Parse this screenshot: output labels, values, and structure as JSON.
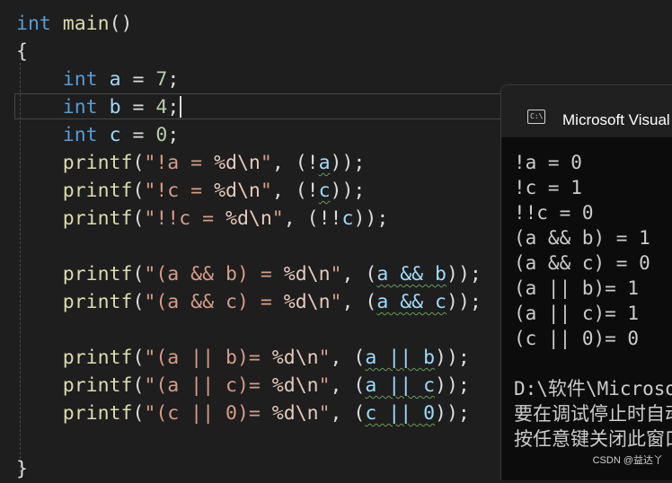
{
  "editor": {
    "lines": [
      {
        "kw": "int",
        "fn": "main",
        "rest": "()"
      },
      {
        "text": "{"
      },
      {
        "kw": "int",
        "var": "a",
        "eq": " = ",
        "num": "7",
        "end": ";"
      },
      {
        "kw": "int",
        "var": "b",
        "eq": " = ",
        "num": "4",
        "end": ";"
      },
      {
        "kw": "int",
        "var": "c",
        "eq": " = ",
        "num": "0",
        "end": ";"
      },
      {
        "fn": "printf",
        "p1": "(",
        "str": "\"!a = ",
        "fmt": "%d",
        "esc": "\\n",
        "q": "\"",
        "mid": ", (!",
        "v": "a",
        "tail": "));"
      },
      {
        "fn": "printf",
        "p1": "(",
        "str": "\"!c = ",
        "fmt": "%d",
        "esc": "\\n",
        "q": "\"",
        "mid": ", (!",
        "v": "c",
        "tail": "));"
      },
      {
        "fn": "printf",
        "p1": "(",
        "str": "\"!!c = ",
        "fmt": "%d",
        "esc": "\\n",
        "q": "\"",
        "mid": ", (!!",
        "v": "c",
        "tail": "));"
      },
      {
        "fn": "printf",
        "p1": "(",
        "str": "\"(a && b) = ",
        "fmt": "%d",
        "esc": "\\n",
        "q": "\"",
        "mid": ", (",
        "expr": "a && b",
        "tail": "));"
      },
      {
        "fn": "printf",
        "p1": "(",
        "str": "\"(a && c) = ",
        "fmt": "%d",
        "esc": "\\n",
        "q": "\"",
        "mid": ", (",
        "expr": "a && c",
        "tail": "));"
      },
      {
        "fn": "printf",
        "p1": "(",
        "str": "\"(a || b)= ",
        "fmt": "%d",
        "esc": "\\n",
        "q": "\"",
        "mid": ", (",
        "expr": "a || b",
        "tail": "));"
      },
      {
        "fn": "printf",
        "p1": "(",
        "str": "\"(a || c)= ",
        "fmt": "%d",
        "esc": "\\n",
        "q": "\"",
        "mid": ", (",
        "expr": "a || c",
        "tail": "));"
      },
      {
        "fn": "printf",
        "p1": "(",
        "str": "\"(c || 0)= ",
        "fmt": "%d",
        "esc": "\\n",
        "q": "\"",
        "mid": ", (",
        "expr": "c || 0",
        "tail": "));"
      },
      {
        "text": "}"
      }
    ]
  },
  "console": {
    "title": "Microsoft Visual Studio 调试控制台",
    "icon_text": "C:\\",
    "output": [
      "!a = 0",
      "!c = 1",
      "!!c = 0",
      "(a && b) = 1",
      "(a && c) = 0",
      "(a || b)= 1",
      "(a || c)= 1",
      "(c || 0)= 0",
      "",
      "D:\\软件\\Microsoft Visual Studio",
      "要在调试停止时自动关闭控制台",
      "按任意键关闭此窗口. . ."
    ]
  },
  "watermark": "CSDN @益达丫",
  "colors": {
    "background": "#1e1e1e",
    "keyword": "#569cd6",
    "function": "#dcdcaa",
    "variable": "#9cdcfe",
    "number": "#b5cea8",
    "string": "#d69d85",
    "console_bg": "#0c0c0c"
  }
}
